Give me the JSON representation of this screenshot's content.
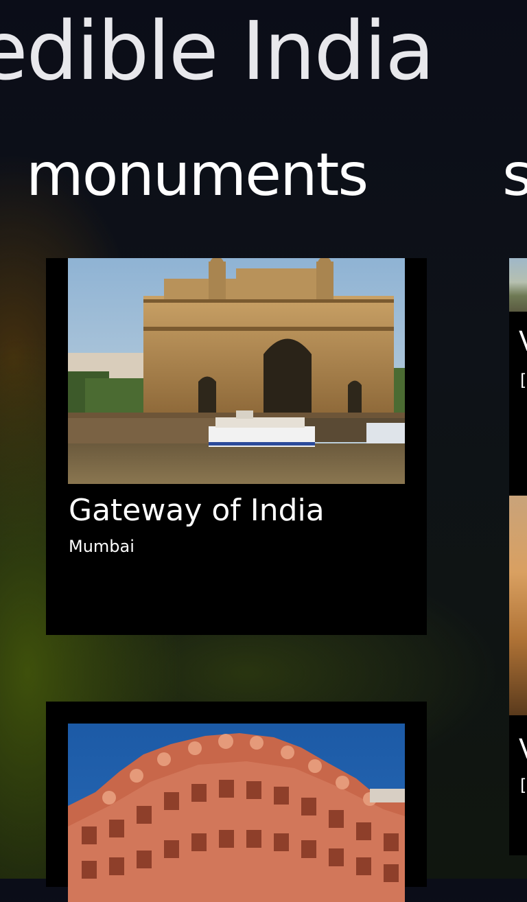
{
  "app": {
    "title": "edible India"
  },
  "pivot": {
    "active": "monuments",
    "next_peek": "s"
  },
  "monuments": [
    {
      "title": "Gateway of India",
      "subtitle": "Mumbai",
      "image_icon": "gateway-of-india-photo"
    },
    {
      "title": "",
      "subtitle": "",
      "image_icon": "hawa-mahal-photo"
    }
  ],
  "side_peek": [
    {
      "title_peek": "V",
      "subtitle_peek": "["
    },
    {
      "title_peek": "V",
      "subtitle_peek": "["
    }
  ],
  "colors": {
    "background": "#0b0d18",
    "card": "#000000",
    "text": "#ffffff"
  }
}
